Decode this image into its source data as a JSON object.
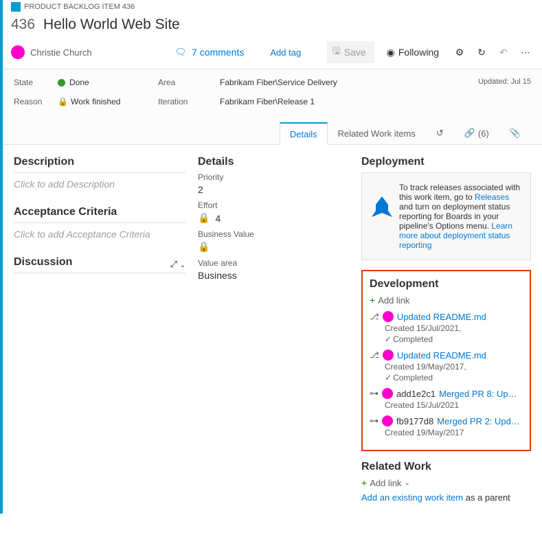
{
  "header": {
    "type_label": "PRODUCT BACKLOG ITEM 436",
    "id": "436",
    "title": "Hello World Web Site"
  },
  "toolbar": {
    "assignee": "Christie Church",
    "comments_count": "7 comments",
    "add_tag": "Add tag",
    "save": "Save",
    "follow": "Following"
  },
  "meta": {
    "updated": "Updated: Jul 15",
    "state_label": "State",
    "state": "Done",
    "reason_label": "Reason",
    "reason": "Work finished",
    "area_label": "Area",
    "area": "Fabrikam Fiber\\Service Delivery",
    "iteration_label": "Iteration",
    "iteration": "Fabrikam Fiber\\Release 1"
  },
  "tabs": {
    "details": "Details",
    "related": "Related Work items",
    "links": "(6)"
  },
  "left": {
    "description": "Description",
    "desc_placeholder": "Click to add Description",
    "acceptance": "Acceptance Criteria",
    "ac_placeholder": "Click to add Acceptance Criteria",
    "discussion": "Discussion"
  },
  "details": {
    "heading": "Details",
    "priority_label": "Priority",
    "priority": "2",
    "effort_label": "Effort",
    "effort": "4",
    "bv_label": "Business Value",
    "va_label": "Value area",
    "va": "Business"
  },
  "deploy": {
    "heading": "Deployment",
    "text1": "To track releases associated with this work item, go to ",
    "releases": "Releases",
    "text2": " and turn on deployment status reporting for Boards in your pipeline's Options menu. ",
    "learn": "Learn more about deployment status reporting"
  },
  "dev": {
    "heading": "Development",
    "add_link": "Add link",
    "items": [
      {
        "type": "pr",
        "title": "Updated README.md",
        "date": "Created 15/Jul/2021,",
        "status": "Completed"
      },
      {
        "type": "pr",
        "title": "Updated README.md",
        "date": "Created 19/May/2017,",
        "status": "Completed"
      },
      {
        "type": "commit",
        "hash": "add1e2c1",
        "title": "Merged PR 8: Up…",
        "date": "Created 15/Jul/2021"
      },
      {
        "type": "commit",
        "hash": "fb9177d8",
        "title": "Merged PR 2: Upd…",
        "date": "Created 19/May/2017"
      }
    ]
  },
  "related": {
    "heading": "Related Work",
    "add_link": "Add link",
    "existing": "Add an existing work item",
    "parent": " as a parent"
  }
}
